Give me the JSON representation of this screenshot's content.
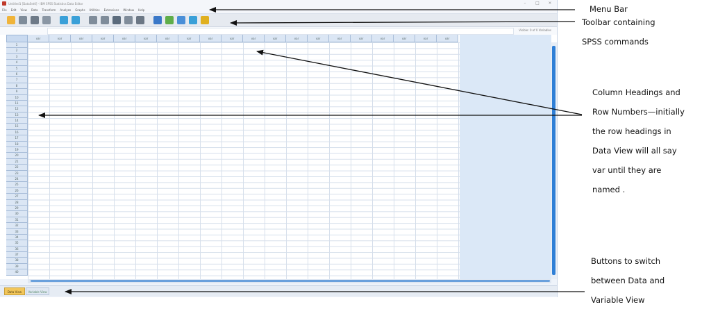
{
  "window": {
    "title": "Untitled1 [DataSet0] - IBM SPSS Statistics Data Editor",
    "controls": [
      "–",
      "□",
      "×"
    ]
  },
  "menubar": {
    "items": [
      "File",
      "Edit",
      "View",
      "Data",
      "Transform",
      "Analyze",
      "Graphs",
      "Utilities",
      "Extensions",
      "Window",
      "Help"
    ]
  },
  "toolbar": {
    "icons": [
      {
        "name": "open-icon",
        "color": "#f0b43a"
      },
      {
        "name": "save-icon",
        "color": "#7f8c9a"
      },
      {
        "name": "print-icon",
        "color": "#6e7a88"
      },
      {
        "name": "dialog-recall-icon",
        "color": "#8a96a4"
      },
      {
        "name": "undo-icon",
        "color": "#3aa0d8"
      },
      {
        "name": "redo-icon",
        "color": "#3aa0d8"
      },
      {
        "name": "goto-case-icon",
        "color": "#7f8c9a"
      },
      {
        "name": "goto-variable-icon",
        "color": "#7f8c9a"
      },
      {
        "name": "variables-icon",
        "color": "#5b6b7c"
      },
      {
        "name": "run-descriptives-icon",
        "color": "#7f8c9a"
      },
      {
        "name": "find-icon",
        "color": "#6b7785"
      },
      {
        "name": "insert-cases-icon",
        "color": "#3a78c8"
      },
      {
        "name": "insert-variable-icon",
        "color": "#5fae4a"
      },
      {
        "name": "split-file-icon",
        "color": "#4a8fd8"
      },
      {
        "name": "weight-cases-icon",
        "color": "#3aa0d8"
      },
      {
        "name": "select-cases-icon",
        "color": "#e0b020"
      }
    ]
  },
  "cellbar": {
    "visible_count": "Visible: 0 of 0 Variables"
  },
  "grid": {
    "col_header": "var",
    "rows": [
      "1",
      "2",
      "3",
      "4",
      "5",
      "6",
      "7",
      "8",
      "9",
      "10",
      "11",
      "12",
      "13",
      "14",
      "15",
      "16",
      "17",
      "18",
      "19",
      "20",
      "21",
      "22",
      "23",
      "24",
      "25",
      "26",
      "27",
      "28",
      "29",
      "30",
      "31",
      "32",
      "33",
      "34",
      "35",
      "36",
      "37",
      "38",
      "39",
      "40"
    ]
  },
  "tabs": {
    "data_view": "Data View",
    "variable_view": "Variable View"
  },
  "annotations": {
    "menu_bar": [
      "Menu Bar"
    ],
    "toolbar": [
      "Toolbar containing",
      "SPSS commands"
    ],
    "headings": [
      "Column Headings and",
      "Row Numbers—initially",
      "the row headings in",
      "Data View  will all say",
      "var until they are",
      "named ."
    ],
    "buttons": [
      "Buttons to switch",
      "between Data and",
      "Variable View"
    ]
  },
  "colors": {
    "arrow": "#111111",
    "accent": "#2f7fd6",
    "data_tab": "#f2c65a"
  }
}
